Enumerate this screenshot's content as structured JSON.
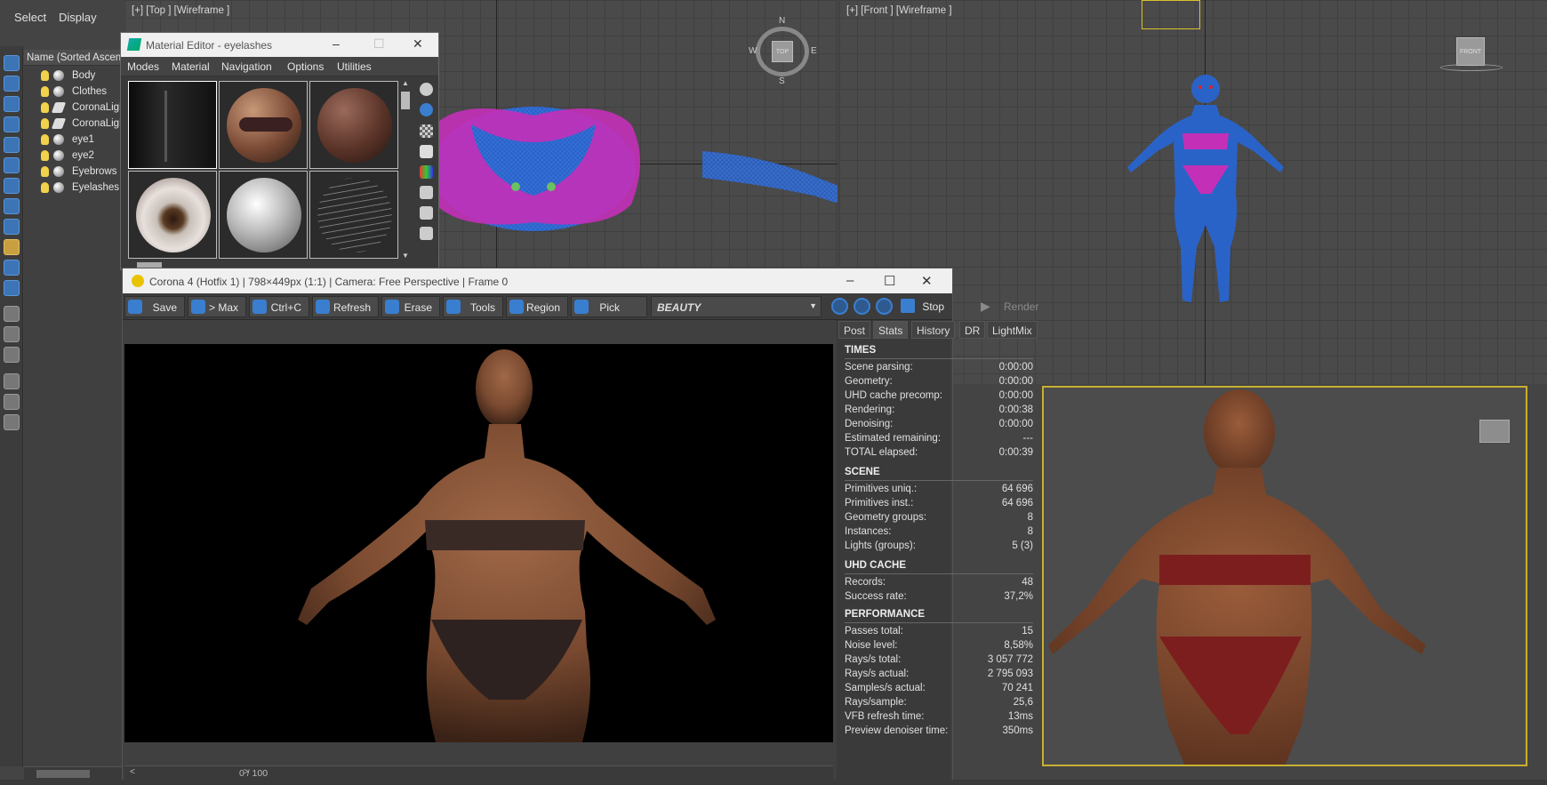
{
  "menu": {
    "select": "Select",
    "display": "Display"
  },
  "scene_explorer": {
    "header": "Name (Sorted Ascend",
    "items": [
      {
        "label": "Body",
        "icon": "sphere-icon"
      },
      {
        "label": "Clothes",
        "icon": "sphere-icon"
      },
      {
        "label": "CoronaLigh",
        "icon": "light-icon"
      },
      {
        "label": "CoronaLigh",
        "icon": "light-icon"
      },
      {
        "label": "eye1",
        "icon": "sphere-icon"
      },
      {
        "label": "eye2",
        "icon": "sphere-icon"
      },
      {
        "label": "Eyebrows",
        "icon": "sphere-icon"
      },
      {
        "label": "Eyelashes",
        "icon": "sphere-icon"
      }
    ]
  },
  "viewports": {
    "top": "[+] [Top ] [Wireframe ]",
    "front": "[+] [Front ] [Wireframe ]",
    "compass": {
      "n": "N",
      "s": "S",
      "e": "E",
      "w": "W",
      "cube": "TOP"
    },
    "front_cube": "FRONT"
  },
  "material_editor": {
    "title": "Material Editor - eyelashes",
    "menu": [
      "Modes",
      "Material",
      "Navigation",
      "Options",
      "Utilities"
    ]
  },
  "vfb": {
    "title": "Corona 4 (Hotfix 1) | 798×449px (1:1) | Camera: Free Perspective | Frame 0",
    "toolbar": {
      "save": "Save",
      "to_max": "> Max",
      "copy": "Ctrl+C",
      "refresh": "Refresh",
      "erase": "Erase",
      "tools": "Tools",
      "region": "Region",
      "pick": "Pick",
      "element": "BEAUTY",
      "stop": "Stop",
      "render": "Render"
    },
    "tabs": [
      "Post",
      "Stats",
      "History",
      "DR",
      "LightMix"
    ],
    "active_tab": "Stats",
    "pagination": "0 / 100",
    "stats": {
      "times_title": "TIMES",
      "times": [
        {
          "k": "Scene parsing:",
          "v": "0:00:00"
        },
        {
          "k": "Geometry:",
          "v": "0:00:00"
        },
        {
          "k": "UHD cache precomp:",
          "v": "0:00:00"
        },
        {
          "k": "Rendering:",
          "v": "0:00:38"
        },
        {
          "k": "Denoising:",
          "v": "0:00:00"
        },
        {
          "k": "Estimated remaining:",
          "v": "---"
        },
        {
          "k": "TOTAL elapsed:",
          "v": "0:00:39"
        }
      ],
      "scene_title": "SCENE",
      "scene": [
        {
          "k": "Primitives uniq.:",
          "v": "64 696"
        },
        {
          "k": "Primitives inst.:",
          "v": "64 696"
        },
        {
          "k": "Geometry groups:",
          "v": "8"
        },
        {
          "k": "Instances:",
          "v": "8"
        },
        {
          "k": "Lights (groups):",
          "v": "5 (3)"
        }
      ],
      "uhd_title": "UHD CACHE",
      "uhd": [
        {
          "k": "Records:",
          "v": "48"
        },
        {
          "k": "Success rate:",
          "v": "37,2%"
        }
      ],
      "perf_title": "PERFORMANCE",
      "perf": [
        {
          "k": "Passes total:",
          "v": "15"
        },
        {
          "k": "Noise level:",
          "v": "8,58%"
        },
        {
          "k": "Rays/s total:",
          "v": "3 057 772"
        },
        {
          "k": "Rays/s actual:",
          "v": "2 795 093"
        },
        {
          "k": "Samples/s actual:",
          "v": "70 241"
        },
        {
          "k": "Rays/sample:",
          "v": "25,6"
        },
        {
          "k": "VFB refresh time:",
          "v": "13ms"
        },
        {
          "k": "Preview denoiser time:",
          "v": "350ms"
        }
      ]
    }
  },
  "colors": {
    "accent_blue": "#3a7ed0",
    "wire_blue": "#2a63c8",
    "wire_magenta": "#c42fb8",
    "selection_yellow": "#c8b030"
  }
}
